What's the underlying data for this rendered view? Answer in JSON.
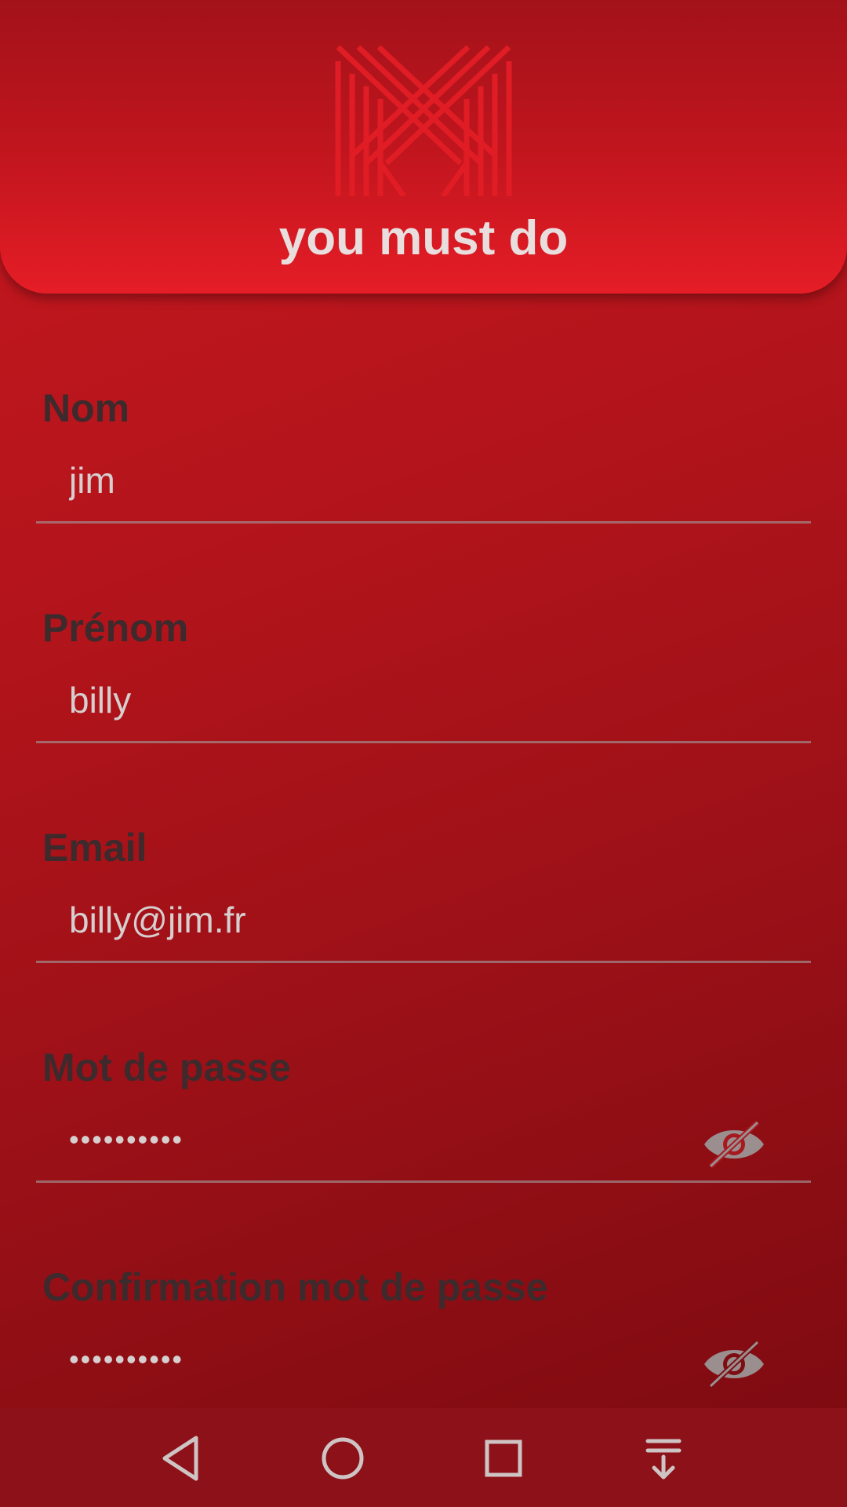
{
  "app": {
    "title": "you must do"
  },
  "form": {
    "nom": {
      "label": "Nom",
      "value": "jim"
    },
    "prenom": {
      "label": "Prénom",
      "value": "billy"
    },
    "email": {
      "label": "Email",
      "value": "billy@jim.fr"
    },
    "password": {
      "label": "Mot de passe",
      "value": "••••••••••"
    },
    "password_confirm": {
      "label": "Confirmation mot de passe",
      "value": "••••••••••"
    }
  },
  "icons": {
    "logo": "m-logo-icon",
    "password_toggle": "eye-off-icon",
    "nav_back": "back-triangle-icon",
    "nav_home": "home-circle-icon",
    "nav_recent": "recent-square-icon",
    "nav_notifications": "pull-down-icon"
  },
  "colors": {
    "background": "#b3141b",
    "header": "#e51d26",
    "title_text": "#e8dede",
    "label_text": "#3d2a2c",
    "input_text": "#d6cfcf",
    "navbar": "#8c1118"
  }
}
